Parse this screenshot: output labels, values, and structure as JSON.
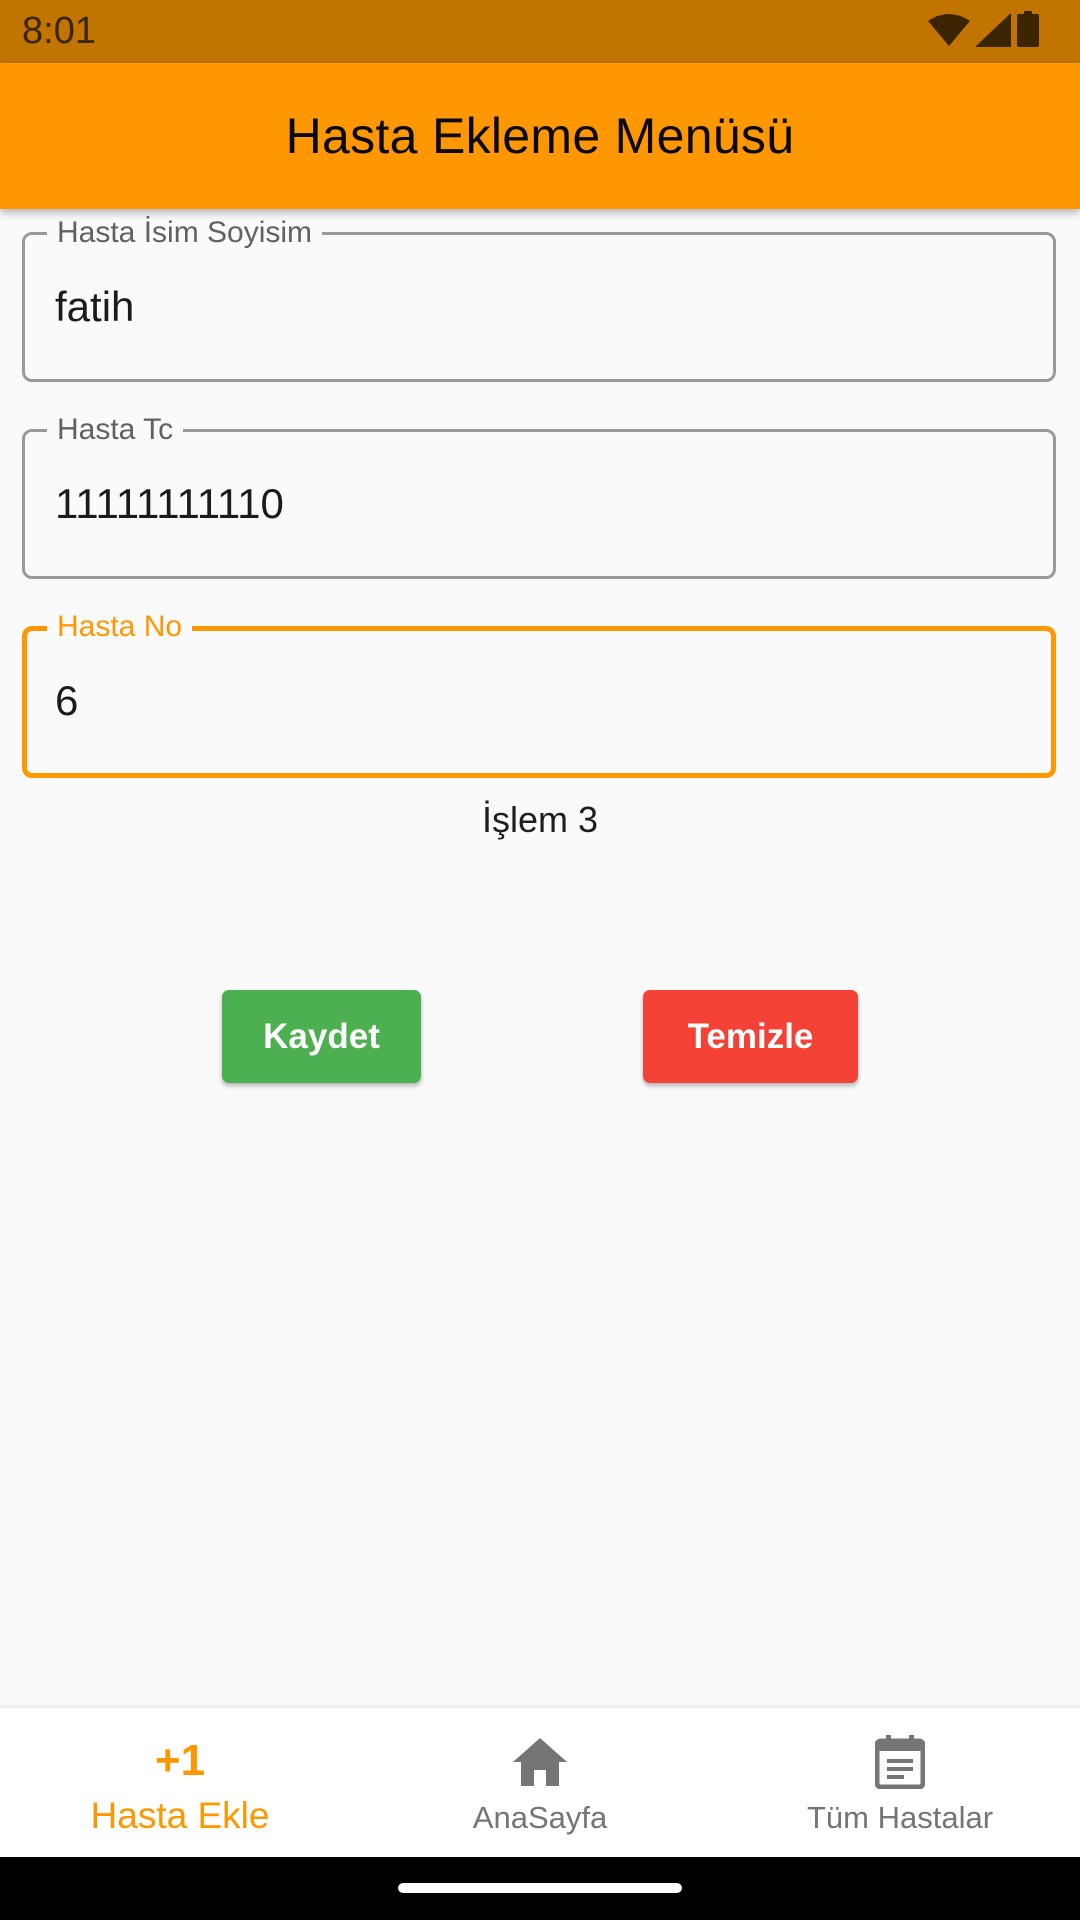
{
  "status_bar": {
    "time": "8:01",
    "icons": [
      "wifi-icon",
      "cell-signal-icon",
      "battery-icon"
    ]
  },
  "app_bar": {
    "title": "Hasta Ekleme Menüsü"
  },
  "form": {
    "name_field": {
      "label": "Hasta İsim Soyisim",
      "value": "fatih"
    },
    "tc_field": {
      "label": "Hasta Tc",
      "value": "11111111110"
    },
    "no_field": {
      "label": "Hasta No",
      "value": "6"
    },
    "status_text": "İşlem 3",
    "save_button": "Kaydet",
    "clear_button": "Temizle"
  },
  "bottom_nav": {
    "items": [
      {
        "icon_text": "+1",
        "label": "Hasta Ekle",
        "active": true
      },
      {
        "icon": "home-icon",
        "label": "AnaSayfa",
        "active": false
      },
      {
        "icon": "calendar-note-icon",
        "label": "Tüm Hastalar",
        "active": false
      }
    ]
  },
  "colors": {
    "accent": "#ff9800",
    "status_bar": "#c17400",
    "save": "#4caf50",
    "clear": "#f44336",
    "inactive": "#757575"
  }
}
